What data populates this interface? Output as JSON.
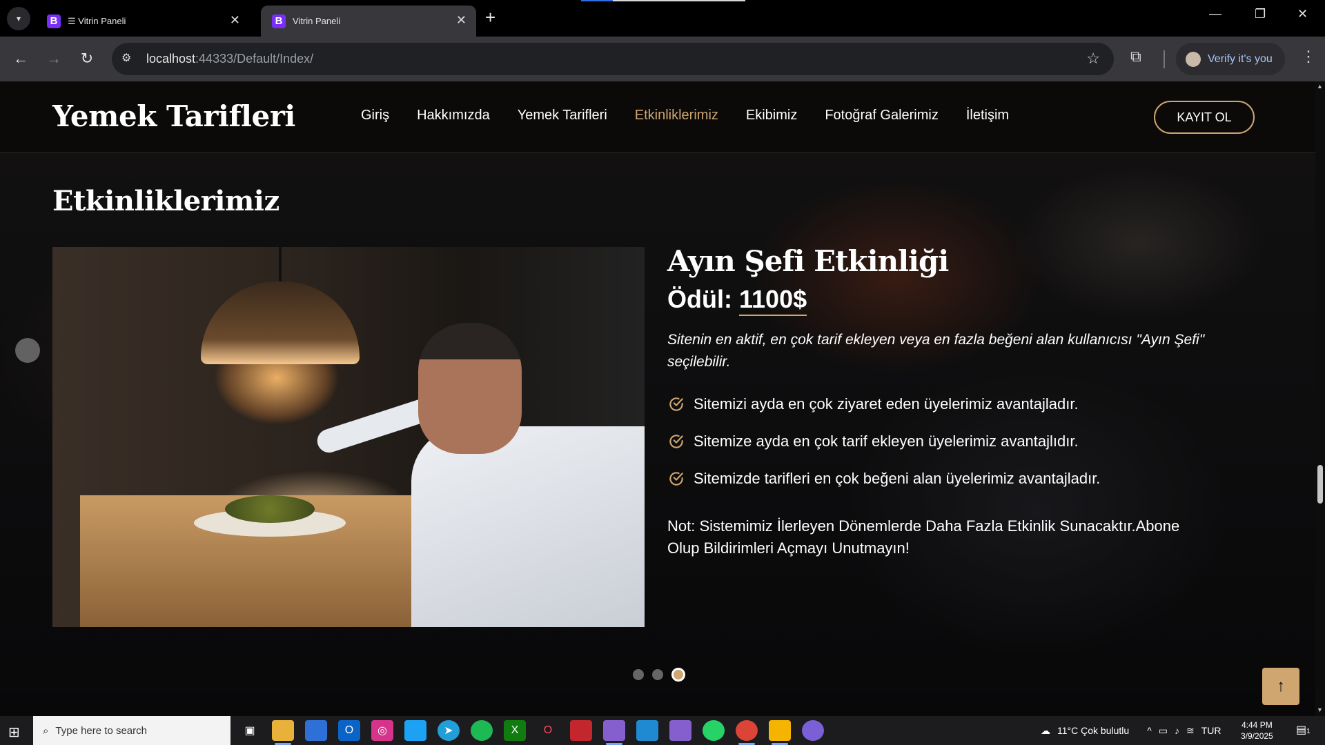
{
  "browser": {
    "tabs": [
      {
        "label": "☰ Vitrin Paneli",
        "favicon": "B"
      },
      {
        "label": "Vitrin Paneli",
        "favicon": "B"
      }
    ],
    "url_host": "localhost",
    "url_path": ":44333/Default/Index/",
    "profile_label": "Verify it's you"
  },
  "site": {
    "logo": "Yemek Tarifleri",
    "nav": [
      "Giriş",
      "Hakkımızda",
      "Yemek Tarifleri",
      "Etkinliklerimiz",
      "Ekibimiz",
      "Fotoğraf Galerimiz",
      "İletişim"
    ],
    "active_nav_index": 3,
    "register_label": "KAYIT OL",
    "accent_color": "#cfa670"
  },
  "section": {
    "title": "Etkinliklerimiz",
    "event": {
      "title": "Ayın Şefi Etkinliği",
      "prize_label": "Ödül:",
      "prize_amount": "1100$",
      "description": "Sitenin en aktif, en çok tarif ekleyen veya en fazla beğeni alan kullanıcısı \"Ayın Şefi\" seçilebilir.",
      "benefits": [
        "Sitemizi ayda en çok ziyaret eden üyelerimiz avantajladır.",
        "Sitemize ayda en çok tarif ekleyen üyelerimiz avantajlıdır.",
        "Sitemizde tarifleri en çok beğeni alan üyelerimiz avantajladır."
      ],
      "note": "Not: Sistemimiz İlerleyen Dönemlerde Daha Fazla Etkinlik Sunacaktır.Abone Olup Bildirimleri Açmayı Unutmayın!"
    },
    "carousel": {
      "slide_count": 3,
      "active_slide": 3
    }
  },
  "taskbar": {
    "search_placeholder": "Type here to search",
    "weather": "11°C  Çok bulutlu",
    "language": "TUR",
    "time": "4:44 PM",
    "date": "3/9/2025",
    "notification_count": "1"
  }
}
